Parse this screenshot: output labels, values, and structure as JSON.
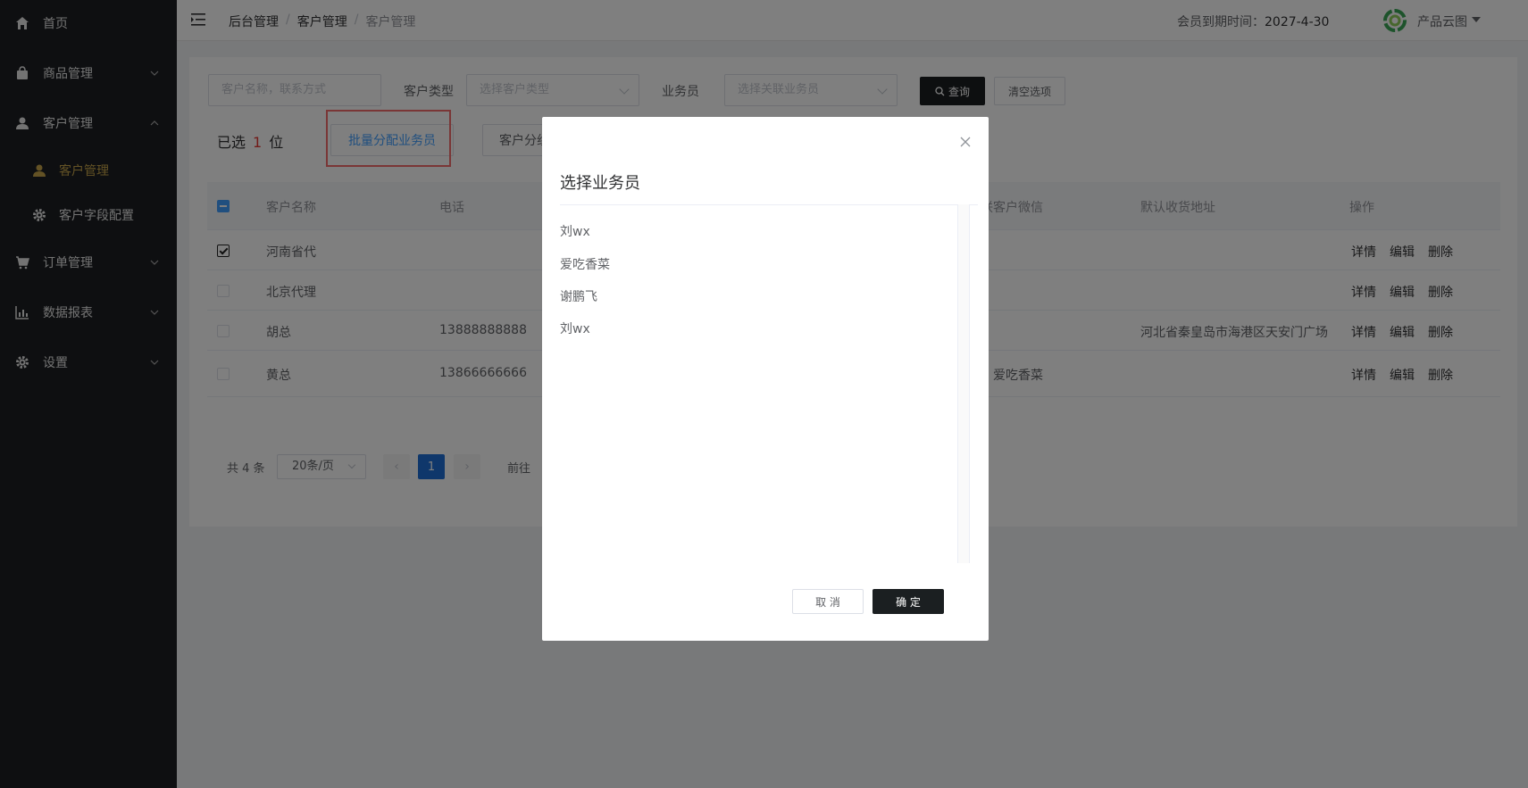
{
  "sidebar": {
    "items": [
      {
        "label": "首页",
        "icon": "home-icon"
      },
      {
        "label": "商品管理",
        "icon": "bag-icon"
      },
      {
        "label": "客户管理",
        "icon": "user-icon"
      },
      {
        "label": "订单管理",
        "icon": "cart-icon"
      },
      {
        "label": "数据报表",
        "icon": "chart-icon"
      },
      {
        "label": "设置",
        "icon": "gear-icon"
      }
    ],
    "sub_items": [
      {
        "label": "客户管理",
        "icon": "user-icon"
      },
      {
        "label": "客户字段配置",
        "icon": "gear-icon"
      }
    ],
    "active_color": "#c7a54a"
  },
  "header": {
    "breadcrumb": [
      "后台管理",
      "客户管理",
      "客户管理"
    ],
    "expire_label": "会员到期时间：",
    "expire_date": "2027-4-30",
    "brand": "产品云图"
  },
  "filters": {
    "search_placeholder": "客户名称，联系方式",
    "type_label": "客户类型",
    "type_placeholder": "选择客户类型",
    "salesman_label": "业务员",
    "salesman_placeholder": "选择关联业务员",
    "query_button": "查询",
    "clear_button": "清空选项"
  },
  "toolbar": {
    "selected_prefix": "已选",
    "selected_count": "1",
    "selected_suffix": "位",
    "batch_assign": "批量分配业务员",
    "partial_button": "客户分组"
  },
  "table": {
    "columns": [
      "客户名称",
      "电话",
      "联客户微信",
      "默认收货地址",
      "操作"
    ],
    "rows": [
      {
        "name": "河南省代",
        "phone": "",
        "wechat": "",
        "address": "",
        "checked": true
      },
      {
        "name": "北京代理",
        "phone": "",
        "wechat": "",
        "address": "",
        "checked": false
      },
      {
        "name": "胡总",
        "phone": "13888888888",
        "wechat": "",
        "address": "河北省秦皇岛市海港区天安门广场",
        "checked": false
      },
      {
        "name": "黄总",
        "phone": "13866666666",
        "wechat": "，爱吃香菜",
        "address": "",
        "checked": false
      }
    ],
    "ops": [
      "详情",
      "编辑",
      "删除"
    ]
  },
  "pagination": {
    "total": "共 4 条",
    "page_size": "20条/页",
    "current": "1",
    "goto": "前往"
  },
  "modal": {
    "title": "选择业务员",
    "items": [
      "刘wx",
      "爱吃香菜",
      "谢鹏飞",
      "刘wx"
    ],
    "cancel": "取 消",
    "ok": "确 定"
  }
}
